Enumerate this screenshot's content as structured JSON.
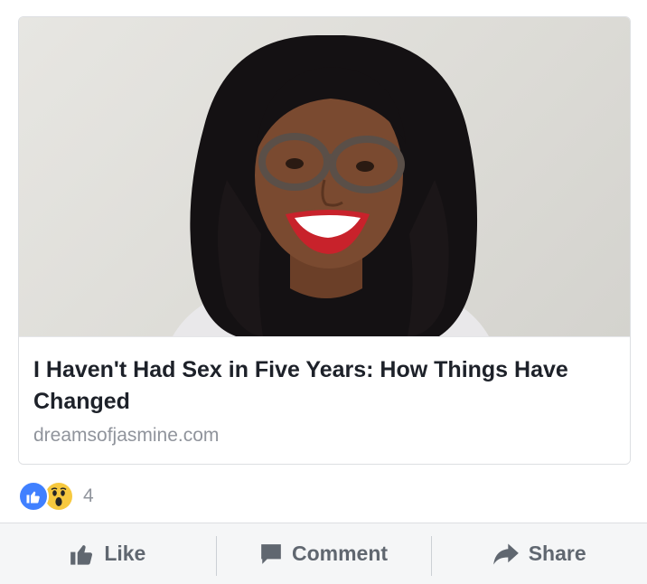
{
  "link_preview": {
    "headline": "I Haven't Had Sex in Five Years: How Things Have Changed",
    "domain": "dreamsofjasmine.com",
    "image_description": "photo-of-smiling-woman-with-glasses"
  },
  "reactions": {
    "icons": [
      "like-icon",
      "wow-icon"
    ],
    "count": "4"
  },
  "actions": {
    "like_label": "Like",
    "comment_label": "Comment",
    "share_label": "Share"
  },
  "colors": {
    "like_blue": "#4080ff",
    "wow_yellow": "#f7c93f",
    "action_gray": "#606770",
    "meta_gray": "#90949c",
    "headline_text": "#1d2129"
  }
}
